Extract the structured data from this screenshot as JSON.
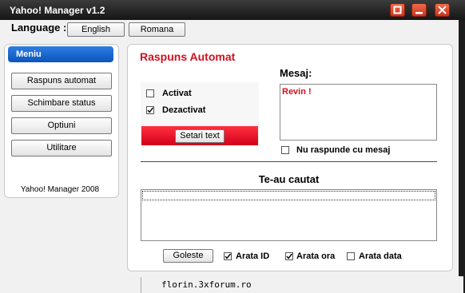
{
  "window": {
    "title": "Yahoo! Manager v1.2"
  },
  "language": {
    "label": "Language :",
    "options": [
      "English",
      "Romana"
    ]
  },
  "menu": {
    "header": "Meniu",
    "items": [
      "Raspuns automat",
      "Schimbare status",
      "Optiuni",
      "Utilitare"
    ],
    "footer": "Yahoo! Manager 2008"
  },
  "auto_reply": {
    "title": "Raspuns Automat",
    "options": [
      {
        "label": "Activat",
        "checked": false
      },
      {
        "label": "Dezactivat",
        "checked": true
      }
    ],
    "setari_button": "Setari text",
    "message_label": "Mesaj:",
    "message_value": "Revin !",
    "no_reply_label": "Nu raspunde cu mesaj",
    "no_reply_checked": false
  },
  "searched": {
    "title": "Te-au cautat",
    "clear_button": "Goleste",
    "options": [
      {
        "label": "Arata ID",
        "checked": true
      },
      {
        "label": "Arata ora",
        "checked": true
      },
      {
        "label": "Arata data",
        "checked": false
      }
    ]
  },
  "statusbar": {
    "text": "florin.3xforum.ro"
  },
  "colors": {
    "accent_red": "#d01020",
    "menu_blue": "#1565d0"
  }
}
